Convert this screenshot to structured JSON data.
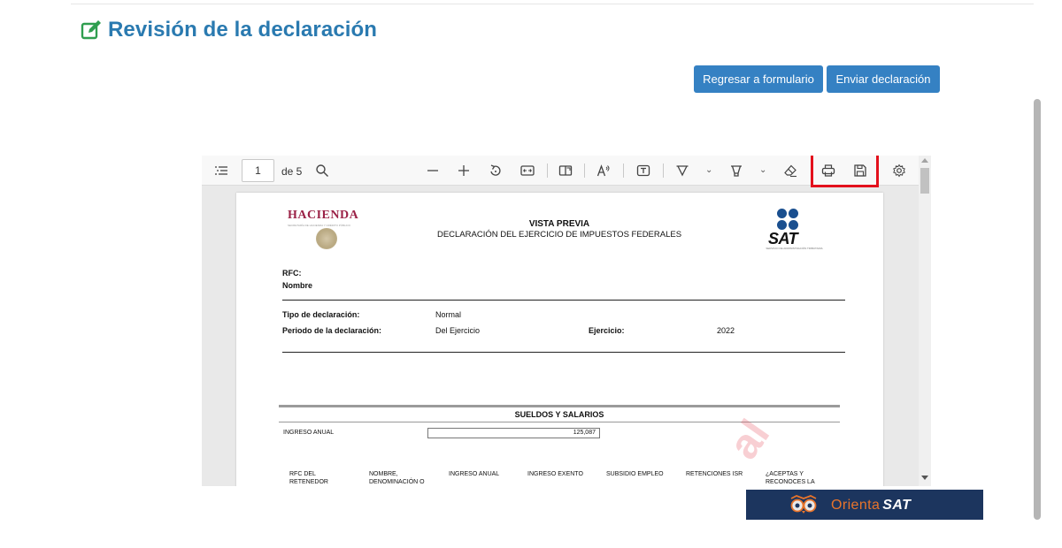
{
  "page": {
    "title": "Revisión de la declaración",
    "title_color": "#2a7ab0",
    "title_icon": "edit-icon"
  },
  "actions": {
    "back_label": "Regresar a formulario",
    "send_label": "Enviar declaración",
    "button_color": "#3581c3"
  },
  "viewer": {
    "toolbar": {
      "current_page": "1",
      "page_count_label": "de 5",
      "icons": [
        "outline-icon",
        "search-icon",
        "zoom-out-icon",
        "zoom-in-icon",
        "rotate-icon",
        "fit-width-icon",
        "two-page-icon",
        "read-aloud-icon",
        "text-box-icon",
        "draw-icon",
        "highlight-icon",
        "eraser-icon",
        "print-icon",
        "save-icon",
        "settings-icon"
      ],
      "highlight_color": "#e3101c"
    },
    "document": {
      "logo_left": "HACIENDA",
      "logo_left_sub": "SECRETARÍA DE HACIENDA Y CRÉDITO PÚBLICO",
      "title": "VISTA PREVIA",
      "subtitle": "DECLARACIÓN DEL EJERCICIO DE IMPUESTOS FEDERALES",
      "logo_right": "SAT",
      "logo_right_sub": "SERVICIO DE ADMINISTRACIÓN TRIBUTARIA",
      "rfc_label": "RFC:",
      "nombre_label": "Nombre",
      "tipo_label": "Tipo de declaración:",
      "tipo_value": "Normal",
      "periodo_label": "Periodo de la declaración:",
      "periodo_value": "Del Ejercicio",
      "ejercicio_label": "Ejercicio:",
      "ejercicio_value": "2022",
      "section_title": "SUELDOS Y SALARIOS",
      "ingreso_label": "INGRESO ANUAL",
      "ingreso_value": "125,087",
      "columns": [
        "RFC DEL RETENEDOR",
        "NOMBRE, DENOMINACIÓN O",
        "INGRESO ANUAL",
        "INGRESO EXENTO",
        "SUBSIDIO EMPLEO",
        "RETENCIONES ISR",
        "¿ACEPTAS Y RECONOCES LA"
      ],
      "watermark": "al"
    }
  },
  "banner": {
    "brand_prefix": "Orienta",
    "brand_suffix": "SAT",
    "background": "#1c355e",
    "accent": "#e8742b"
  }
}
